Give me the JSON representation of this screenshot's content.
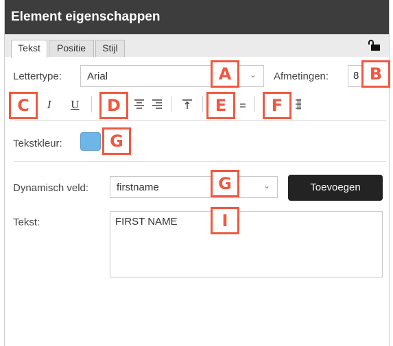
{
  "panel": {
    "title": "Element eigenschappen",
    "tabs": [
      {
        "label": "Tekst",
        "active": true
      },
      {
        "label": "Positie",
        "active": false
      },
      {
        "label": "Stijl",
        "active": false
      }
    ],
    "lock_icon": "unlock-icon"
  },
  "font_row": {
    "font_label": "Lettertype:",
    "font_value": "Arial",
    "size_label": "Afmetingen:",
    "size_value": "8"
  },
  "format_row": {
    "italic": "I",
    "underline": "U"
  },
  "color_row": {
    "label": "Tekstkleur:",
    "color": "#6eb6e8"
  },
  "dynamic_row": {
    "label": "Dynamisch veld:",
    "value": "firstname",
    "button_label": "Toevoegen"
  },
  "text_row": {
    "label": "Tekst:",
    "value": "FIRST NAME"
  },
  "markers": {
    "a": "A",
    "b": "B",
    "c": "C",
    "d": "D",
    "e": "E",
    "f": "F",
    "g1": "G",
    "g2": "G",
    "i": "I"
  },
  "colors": {
    "titlebar": "#3d3d3d",
    "marker": "#f2573f",
    "button": "#232323"
  }
}
